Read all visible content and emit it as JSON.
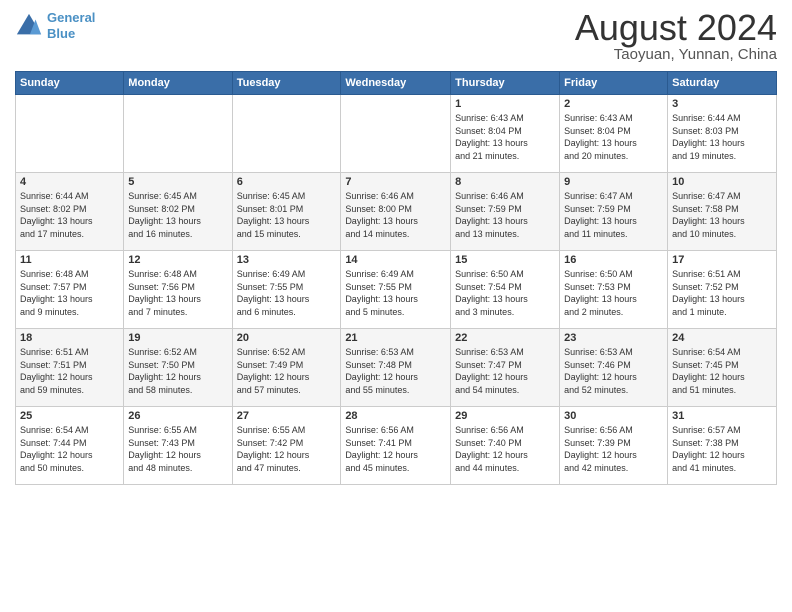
{
  "logo": {
    "line1": "General",
    "line2": "Blue"
  },
  "title": "August 2024",
  "subtitle": "Taoyuan, Yunnan, China",
  "weekdays": [
    "Sunday",
    "Monday",
    "Tuesday",
    "Wednesday",
    "Thursday",
    "Friday",
    "Saturday"
  ],
  "weeks": [
    [
      {
        "day": "",
        "info": ""
      },
      {
        "day": "",
        "info": ""
      },
      {
        "day": "",
        "info": ""
      },
      {
        "day": "",
        "info": ""
      },
      {
        "day": "1",
        "info": "Sunrise: 6:43 AM\nSunset: 8:04 PM\nDaylight: 13 hours\nand 21 minutes."
      },
      {
        "day": "2",
        "info": "Sunrise: 6:43 AM\nSunset: 8:04 PM\nDaylight: 13 hours\nand 20 minutes."
      },
      {
        "day": "3",
        "info": "Sunrise: 6:44 AM\nSunset: 8:03 PM\nDaylight: 13 hours\nand 19 minutes."
      }
    ],
    [
      {
        "day": "4",
        "info": "Sunrise: 6:44 AM\nSunset: 8:02 PM\nDaylight: 13 hours\nand 17 minutes."
      },
      {
        "day": "5",
        "info": "Sunrise: 6:45 AM\nSunset: 8:02 PM\nDaylight: 13 hours\nand 16 minutes."
      },
      {
        "day": "6",
        "info": "Sunrise: 6:45 AM\nSunset: 8:01 PM\nDaylight: 13 hours\nand 15 minutes."
      },
      {
        "day": "7",
        "info": "Sunrise: 6:46 AM\nSunset: 8:00 PM\nDaylight: 13 hours\nand 14 minutes."
      },
      {
        "day": "8",
        "info": "Sunrise: 6:46 AM\nSunset: 7:59 PM\nDaylight: 13 hours\nand 13 minutes."
      },
      {
        "day": "9",
        "info": "Sunrise: 6:47 AM\nSunset: 7:59 PM\nDaylight: 13 hours\nand 11 minutes."
      },
      {
        "day": "10",
        "info": "Sunrise: 6:47 AM\nSunset: 7:58 PM\nDaylight: 13 hours\nand 10 minutes."
      }
    ],
    [
      {
        "day": "11",
        "info": "Sunrise: 6:48 AM\nSunset: 7:57 PM\nDaylight: 13 hours\nand 9 minutes."
      },
      {
        "day": "12",
        "info": "Sunrise: 6:48 AM\nSunset: 7:56 PM\nDaylight: 13 hours\nand 7 minutes."
      },
      {
        "day": "13",
        "info": "Sunrise: 6:49 AM\nSunset: 7:55 PM\nDaylight: 13 hours\nand 6 minutes."
      },
      {
        "day": "14",
        "info": "Sunrise: 6:49 AM\nSunset: 7:55 PM\nDaylight: 13 hours\nand 5 minutes."
      },
      {
        "day": "15",
        "info": "Sunrise: 6:50 AM\nSunset: 7:54 PM\nDaylight: 13 hours\nand 3 minutes."
      },
      {
        "day": "16",
        "info": "Sunrise: 6:50 AM\nSunset: 7:53 PM\nDaylight: 13 hours\nand 2 minutes."
      },
      {
        "day": "17",
        "info": "Sunrise: 6:51 AM\nSunset: 7:52 PM\nDaylight: 13 hours\nand 1 minute."
      }
    ],
    [
      {
        "day": "18",
        "info": "Sunrise: 6:51 AM\nSunset: 7:51 PM\nDaylight: 12 hours\nand 59 minutes."
      },
      {
        "day": "19",
        "info": "Sunrise: 6:52 AM\nSunset: 7:50 PM\nDaylight: 12 hours\nand 58 minutes."
      },
      {
        "day": "20",
        "info": "Sunrise: 6:52 AM\nSunset: 7:49 PM\nDaylight: 12 hours\nand 57 minutes."
      },
      {
        "day": "21",
        "info": "Sunrise: 6:53 AM\nSunset: 7:48 PM\nDaylight: 12 hours\nand 55 minutes."
      },
      {
        "day": "22",
        "info": "Sunrise: 6:53 AM\nSunset: 7:47 PM\nDaylight: 12 hours\nand 54 minutes."
      },
      {
        "day": "23",
        "info": "Sunrise: 6:53 AM\nSunset: 7:46 PM\nDaylight: 12 hours\nand 52 minutes."
      },
      {
        "day": "24",
        "info": "Sunrise: 6:54 AM\nSunset: 7:45 PM\nDaylight: 12 hours\nand 51 minutes."
      }
    ],
    [
      {
        "day": "25",
        "info": "Sunrise: 6:54 AM\nSunset: 7:44 PM\nDaylight: 12 hours\nand 50 minutes."
      },
      {
        "day": "26",
        "info": "Sunrise: 6:55 AM\nSunset: 7:43 PM\nDaylight: 12 hours\nand 48 minutes."
      },
      {
        "day": "27",
        "info": "Sunrise: 6:55 AM\nSunset: 7:42 PM\nDaylight: 12 hours\nand 47 minutes."
      },
      {
        "day": "28",
        "info": "Sunrise: 6:56 AM\nSunset: 7:41 PM\nDaylight: 12 hours\nand 45 minutes."
      },
      {
        "day": "29",
        "info": "Sunrise: 6:56 AM\nSunset: 7:40 PM\nDaylight: 12 hours\nand 44 minutes."
      },
      {
        "day": "30",
        "info": "Sunrise: 6:56 AM\nSunset: 7:39 PM\nDaylight: 12 hours\nand 42 minutes."
      },
      {
        "day": "31",
        "info": "Sunrise: 6:57 AM\nSunset: 7:38 PM\nDaylight: 12 hours\nand 41 minutes."
      }
    ]
  ]
}
